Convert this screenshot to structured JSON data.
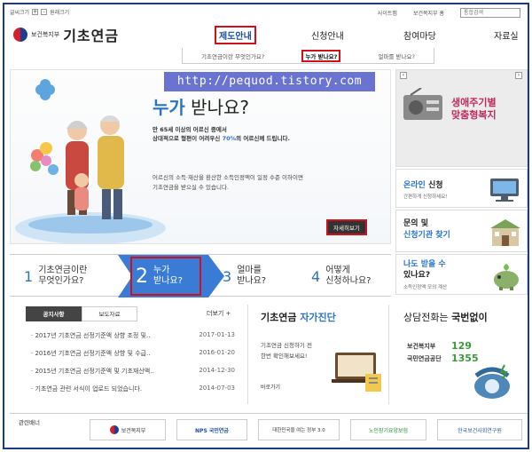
{
  "util": {
    "left_text": "글씨크기",
    "zoom_in": "+",
    "zoom_out": "-",
    "default_size": "원래크기",
    "sitemap": "사이트맵",
    "ministry_home": "보건복지부 홈",
    "search_placeholder": "통합검색"
  },
  "logo": {
    "ministry": "보건복지부",
    "title": "기초연금"
  },
  "nav": {
    "items": [
      "제도안내",
      "신청안내",
      "참여마당",
      "자료실"
    ],
    "active_index": 0,
    "sub_items": [
      "기초연금이란 무엇인가요?",
      "누가 받나요?",
      "얼마를 받나요?"
    ],
    "sub_active_index": 1
  },
  "watermark": "http://pequod.tistory.com",
  "hero": {
    "title_accent": "누가",
    "title_rest": " 받나요?",
    "desc_line1": "만 65세 이상의 어르신 중에서",
    "desc_line2_pre": "상대적으로 형편이 어려우신 ",
    "desc_line2_accent": "70%",
    "desc_line2_post": "의 어르신께 드립니다.",
    "desc2_line1": "어르신의 소득·재산을 환산한 소득인정액이 일정 수준 이하이면",
    "desc2_line2": "기초연금을 받으실 수 있습니다.",
    "more_button": "자세히보기"
  },
  "banner": {
    "script_line1": "생애주기별",
    "script_line2": "맞춤형복지"
  },
  "side": {
    "online_accent": "온라인",
    "online_rest": " 신청",
    "online_sub": "간편하게 신청하세요!",
    "inquiry_line1": "문의 및",
    "inquiry_line2": "신청기관 찾기",
    "mine_line1": "나도 받을 수",
    "mine_line2": "있나요?",
    "mine_sub": "소득인정액 모의 계산"
  },
  "steps": [
    {
      "num": "1",
      "line1": "기초연금이란",
      "line2": "무엇인가요?"
    },
    {
      "num": "2",
      "line1": "누가",
      "line2": "받나요?"
    },
    {
      "num": "3",
      "line1": "얼마를",
      "line2": "받나요?"
    },
    {
      "num": "4",
      "line1": "어떻게",
      "line2": "신청하나요?"
    }
  ],
  "notices": {
    "tabs": [
      "공지사항",
      "보도자료"
    ],
    "more": "더보기 +",
    "items": [
      {
        "title": "· 2017년 기초연금 선정기준액 상향 조정 및..",
        "date": "2017-01-13"
      },
      {
        "title": "· 2016년 기초연금 선정기준액 상향 및 수급..",
        "date": "2016-01-20"
      },
      {
        "title": "· 2015년 기초연금 선정기준액 및 기초재산액..",
        "date": "2014-12-30"
      },
      {
        "title": "· 기초연금 관련 서식이 업로드 되었습니다.",
        "date": "2014-07-03"
      }
    ]
  },
  "self_check": {
    "title_pre": "기초연금 ",
    "title_accent": "자가진단",
    "line1": "기초연금 신청하기 전",
    "line2": "한번 확인해보세요!",
    "go": "바로가기"
  },
  "phone": {
    "title_pre": "상담전화는 ",
    "title_bold": "국번없이",
    "org1": "보건복지부",
    "num1": "129",
    "org2": "국민연금공단",
    "num2": "1355"
  },
  "related": {
    "label": "관련배너",
    "banners": [
      "보건복지부",
      "NPS 국민연금",
      "대한민국을 여는 정부 3.0",
      "노인장기요양보험",
      "한국보건사회연구원"
    ]
  }
}
